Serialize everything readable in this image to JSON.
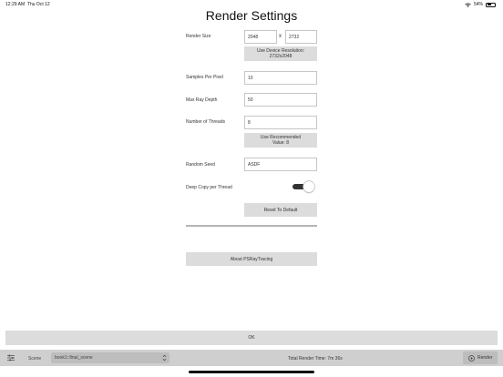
{
  "status_bar": {
    "time": "12:29 AM",
    "date": "Thu Oct 12",
    "battery": "54%"
  },
  "title": "Render Settings",
  "render_size": {
    "label": "Render Size",
    "width": "2048",
    "separator": "x",
    "height": "2732",
    "device_button_line1": "Use Device Resolution:",
    "device_button_line2": "2732x2048"
  },
  "samples": {
    "label": "Samples Per Pixel",
    "value": "10"
  },
  "max_depth": {
    "label": "Max Ray Depth",
    "value": "50"
  },
  "threads": {
    "label": "Number of Threads",
    "value": "8",
    "recommend_line1": "Use Recommended",
    "recommend_line2": "Value: 8"
  },
  "seed": {
    "label": "Random Seed",
    "value": "ASDF"
  },
  "deep_copy": {
    "label": "Deep Copy per Thread",
    "enabled": true
  },
  "reset_label": "Reset To Default",
  "about_label": "About PSRayTracing",
  "ok_label": "OK",
  "bottom_bar": {
    "scene_label": "Scene",
    "scene_value": "book1::final_scene",
    "render_time": "Total Render Time: 7m 36s",
    "render_button": "Render"
  },
  "colors": {
    "button_bg": "#dcdcdc",
    "bottom_bar_bg": "#cfcfcf",
    "toggle_on": "#333333"
  }
}
